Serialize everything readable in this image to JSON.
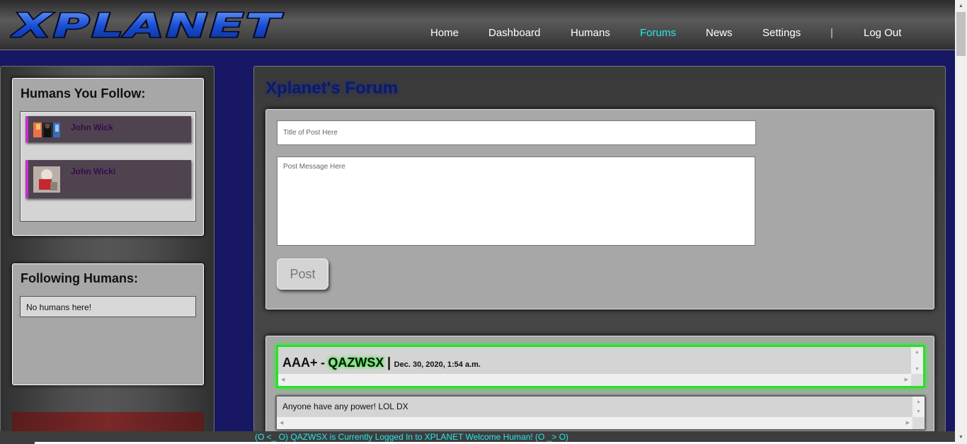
{
  "header": {
    "logo_text": "XPLANET",
    "nav": [
      {
        "label": "Home"
      },
      {
        "label": "Dashboard"
      },
      {
        "label": "Humans"
      },
      {
        "label": "Forums",
        "active": true
      },
      {
        "label": "News"
      },
      {
        "label": "Settings"
      },
      {
        "label": "Log Out"
      }
    ],
    "separator": "|"
  },
  "sidebar": {
    "following_title": "Humans You Follow:",
    "following": [
      {
        "name": "John Wick"
      },
      {
        "name": "John Wicki"
      }
    ],
    "followers_title": "Following Humans:",
    "followers_empty": "No humans here!"
  },
  "main": {
    "title": "Xplanet's Forum",
    "compose": {
      "title_placeholder": "Title of Post Here",
      "message_placeholder": "Post Message Here",
      "post_button": "Post"
    },
    "posts": [
      {
        "topic": "AAA+",
        "dash": "-",
        "author": "QAZWSX",
        "bar": "|",
        "date": "Dec. 30, 2020, 1:54 a.m.",
        "message": "Anyone have any power! LOL DX"
      }
    ]
  },
  "status": {
    "text": "(O <_ O) QAZWSX is Currently Logged In to XPLANET Welcome Human! (O _> O)"
  },
  "colors": {
    "background": "#171763",
    "accent_cyan": "#28e6ea",
    "post_glow": "#28e02a",
    "follow_accent": "#c42fc9"
  }
}
